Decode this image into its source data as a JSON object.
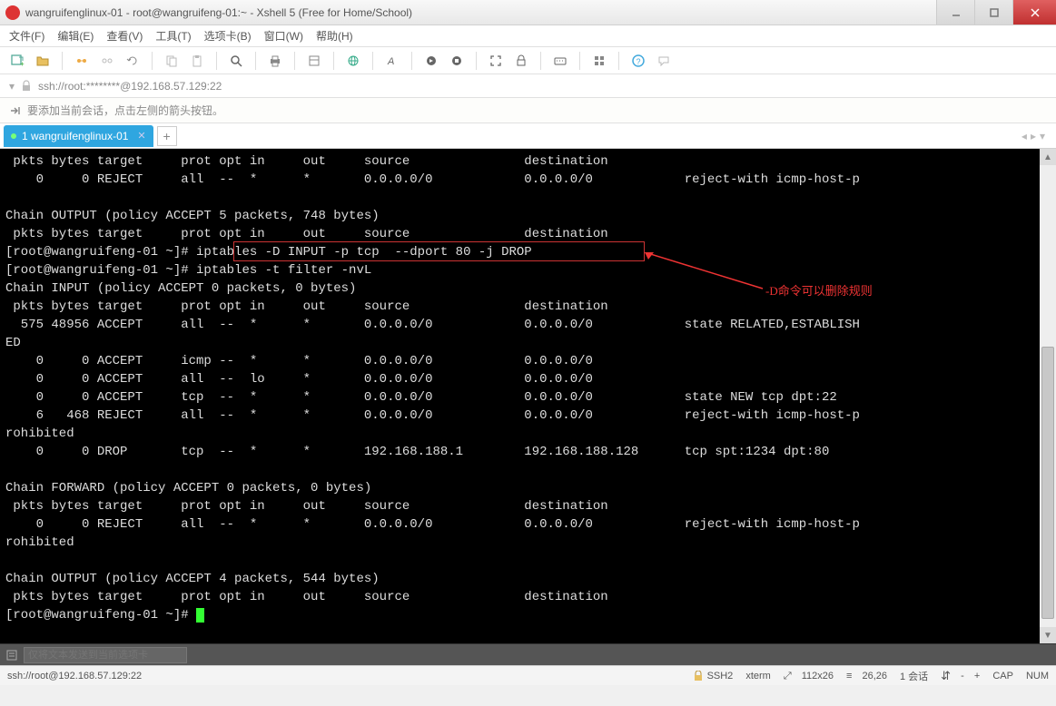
{
  "window": {
    "title": "wangruifenglinux-01 - root@wangruifeng-01:~ - Xshell 5 (Free for Home/School)"
  },
  "menu": {
    "file": "文件(F)",
    "edit": "编辑(E)",
    "view": "查看(V)",
    "tools": "工具(T)",
    "tab": "选项卡(B)",
    "window": "窗口(W)",
    "help": "帮助(H)"
  },
  "address": {
    "url": "ssh://root:********@192.168.57.129:22"
  },
  "hint": {
    "text": "要添加当前会话，点击左侧的箭头按钮。"
  },
  "tab": {
    "label": "1 wangruifenglinux-01"
  },
  "terminal": {
    "lines": [
      " pkts bytes target     prot opt in     out     source               destination",
      "    0     0 REJECT     all  --  *      *       0.0.0.0/0            0.0.0.0/0            reject-with icmp-host-p",
      "",
      "Chain OUTPUT (policy ACCEPT 5 packets, 748 bytes)",
      " pkts bytes target     prot opt in     out     source               destination",
      "[root@wangruifeng-01 ~]# iptables -D INPUT -p tcp  --dport 80 -j DROP",
      "[root@wangruifeng-01 ~]# iptables -t filter -nvL",
      "Chain INPUT (policy ACCEPT 0 packets, 0 bytes)",
      " pkts bytes target     prot opt in     out     source               destination",
      "  575 48956 ACCEPT     all  --  *      *       0.0.0.0/0            0.0.0.0/0            state RELATED,ESTABLISH",
      "ED",
      "    0     0 ACCEPT     icmp --  *      *       0.0.0.0/0            0.0.0.0/0",
      "    0     0 ACCEPT     all  --  lo     *       0.0.0.0/0            0.0.0.0/0",
      "    0     0 ACCEPT     tcp  --  *      *       0.0.0.0/0            0.0.0.0/0            state NEW tcp dpt:22",
      "    6   468 REJECT     all  --  *      *       0.0.0.0/0            0.0.0.0/0            reject-with icmp-host-p",
      "rohibited",
      "    0     0 DROP       tcp  --  *      *       192.168.188.1        192.168.188.128      tcp spt:1234 dpt:80",
      "",
      "Chain FORWARD (policy ACCEPT 0 packets, 0 bytes)",
      " pkts bytes target     prot opt in     out     source               destination",
      "    0     0 REJECT     all  --  *      *       0.0.0.0/0            0.0.0.0/0            reject-with icmp-host-p",
      "rohibited",
      "",
      "Chain OUTPUT (policy ACCEPT 4 packets, 544 bytes)",
      " pkts bytes target     prot opt in     out     source               destination",
      "[root@wangruifeng-01 ~]# "
    ],
    "highlighted_command": "iptables -D INPUT -p tcp  --dport 80 -j DROP",
    "annotation": "-D命令可以删除规则"
  },
  "inputbar": {
    "placeholder": "仅将文本发送到当前选项卡"
  },
  "status": {
    "conn": "ssh://root@192.168.57.129:22",
    "ssh": "SSH2",
    "term": "xterm",
    "size": "112x26",
    "pos": "26,26",
    "sessions": "1 会话",
    "caps": "CAP",
    "num": "NUM"
  }
}
